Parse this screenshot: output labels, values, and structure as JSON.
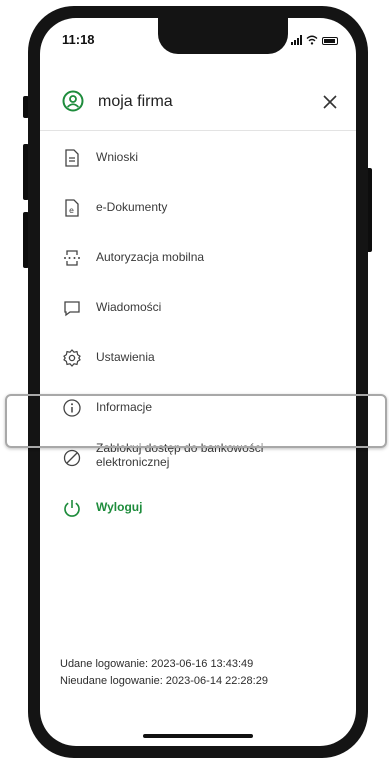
{
  "status_bar": {
    "time": "11:18"
  },
  "header": {
    "title": "moja firma"
  },
  "menu": {
    "items": [
      {
        "label": "Wnioski",
        "icon": "document-lines-icon"
      },
      {
        "label": "e-Dokumenty",
        "icon": "e-document-icon"
      },
      {
        "label": "Autoryzacja mobilna",
        "icon": "mobile-authorization-icon"
      },
      {
        "label": "Wiadomości",
        "icon": "message-icon"
      },
      {
        "label": "Ustawienia",
        "icon": "gear-icon"
      },
      {
        "label": "Informacje",
        "icon": "info-icon"
      },
      {
        "label": "Zablokuj dostęp do bankowości elektronicznej",
        "icon": "block-icon"
      },
      {
        "label": "Wyloguj",
        "icon": "power-icon"
      }
    ]
  },
  "footer": {
    "last_login": "Udane logowanie: 2023-06-16 13:43:49",
    "last_failed_login": "Nieudane logowanie: 2023-06-14 22:28:29"
  },
  "colors": {
    "accent": "#1e8c3c",
    "text": "#3a3a3a"
  }
}
